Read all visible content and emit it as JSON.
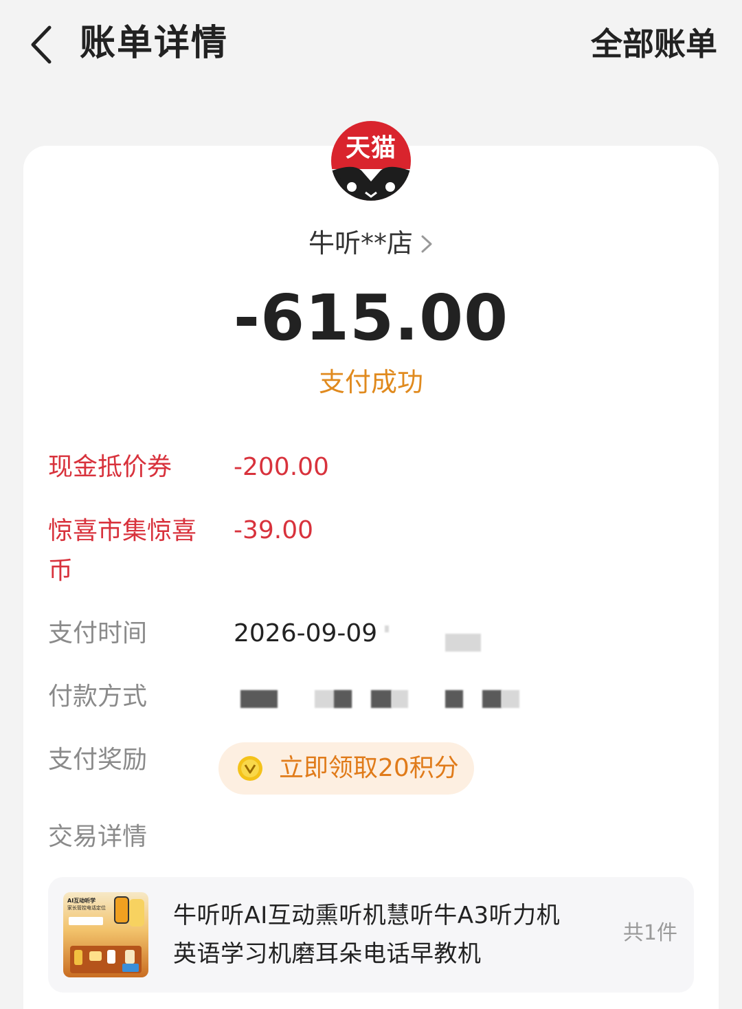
{
  "header": {
    "title": "账单详情",
    "all_bills": "全部账单"
  },
  "merchant": {
    "logo_text": "天猫",
    "name": "牛听**店"
  },
  "transaction": {
    "amount": "-615.00",
    "status": "支付成功"
  },
  "details": {
    "coupon_label": "现金抵价券",
    "coupon_value": "-200.00",
    "coins_label": "惊喜市集惊喜币",
    "coins_value": "-39.00",
    "pay_time_label": "支付时间",
    "pay_time_value": "2026-09-09",
    "pay_method_label": "付款方式",
    "reward_label": "支付奖励",
    "reward_button": "立即领取20积分",
    "trade_detail_label": "交易详情"
  },
  "product": {
    "title": "牛听听AI互动熏听机慧听牛A3听力机英语学习机磨耳朵电话早教机",
    "count": "共1件",
    "thumb_caption_1": "AI互动听学",
    "thumb_caption_2": "家长管控电话定位"
  },
  "colors": {
    "accent_red": "#d8323c",
    "status_orange": "#e08a1e",
    "tmall_red": "#d9242d"
  },
  "icons": {
    "back": "back-arrow-icon",
    "merchant_chevron": "chevron-right-icon",
    "reward": "coin-icon"
  }
}
